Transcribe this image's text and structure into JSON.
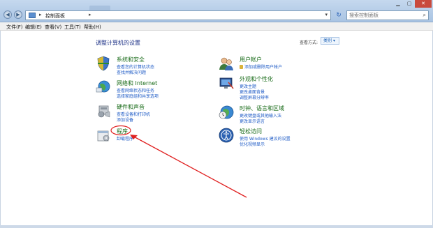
{
  "address_bar": {
    "crumb": "控制面板",
    "search_placeholder": "搜索控制面板"
  },
  "menu": [
    {
      "label": "文件(F)"
    },
    {
      "label": "编辑(E)"
    },
    {
      "label": "查看(V)"
    },
    {
      "label": "工具(T)"
    },
    {
      "label": "帮助(H)"
    }
  ],
  "heading": "调整计算机的设置",
  "view_by": {
    "label": "查看方式:",
    "value": "类别"
  },
  "left_categories": [
    {
      "title": "系统和安全",
      "links": [
        "查看您的计算机状态",
        "查找并解决问题"
      ],
      "icon": "system-security-icon"
    },
    {
      "title": "网络和 Internet",
      "links": [
        "查看网络状态和任务",
        "选择家庭组和共享选项"
      ],
      "icon": "network-icon"
    },
    {
      "title": "硬件和声音",
      "links": [
        "查看设备和打印机",
        "添加设备"
      ],
      "icon": "hardware-sound-icon"
    },
    {
      "title": "程序",
      "links": [
        "卸载程序"
      ],
      "icon": "programs-icon"
    }
  ],
  "right_categories": [
    {
      "title": "用户帐户",
      "links": [
        "添加或删除用户帐户"
      ],
      "icon": "user-accounts-icon"
    },
    {
      "title": "外观和个性化",
      "links": [
        "更改主题",
        "更改桌面背景",
        "调整屏幕分辨率"
      ],
      "icon": "appearance-icon"
    },
    {
      "title": "时钟、语言和区域",
      "links": [
        "更改键盘或其他输入法",
        "更改显示语言"
      ],
      "icon": "clock-region-icon"
    },
    {
      "title": "轻松访问",
      "links": [
        "使用 Windows 建议的设置",
        "优化视频显示"
      ],
      "icon": "ease-access-icon"
    }
  ],
  "colors": {
    "category_title": "#1a6c1a",
    "link": "#1e5bc6",
    "annotation_red": "#e02020"
  }
}
